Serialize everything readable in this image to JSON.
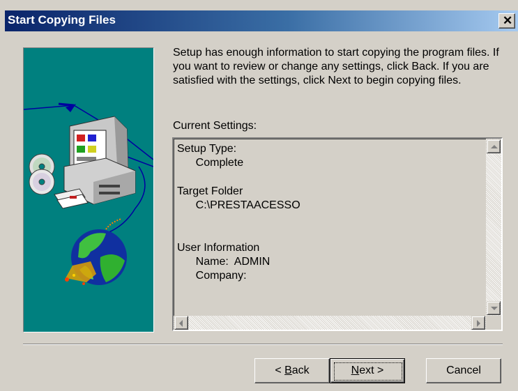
{
  "window": {
    "title": "Start Copying Files",
    "close_glyph": "✕"
  },
  "description": "Setup has enough information to start copying the program files. If you want to review or change any settings, click Back.  If you are satisfied with the settings, click Next to begin copying files.",
  "settings": {
    "label": "Current Settings:",
    "lines": [
      "Setup Type:",
      "      Complete",
      "Target Folder",
      "      C:\\PRESTAACESSO",
      "User Information",
      "      Name:  ADMIN",
      "      Company:"
    ]
  },
  "buttons": {
    "back": {
      "accel": "B",
      "rest": "ack",
      "prefix": "< "
    },
    "next": {
      "accel": "N",
      "rest": "ext >"
    },
    "cancel": "Cancel"
  },
  "icons": [
    "computer-icon",
    "cd-icon",
    "floppy-icon",
    "globe-icon",
    "close-icon",
    "scroll-up-icon",
    "scroll-down-icon",
    "scroll-left-icon",
    "scroll-right-icon"
  ]
}
